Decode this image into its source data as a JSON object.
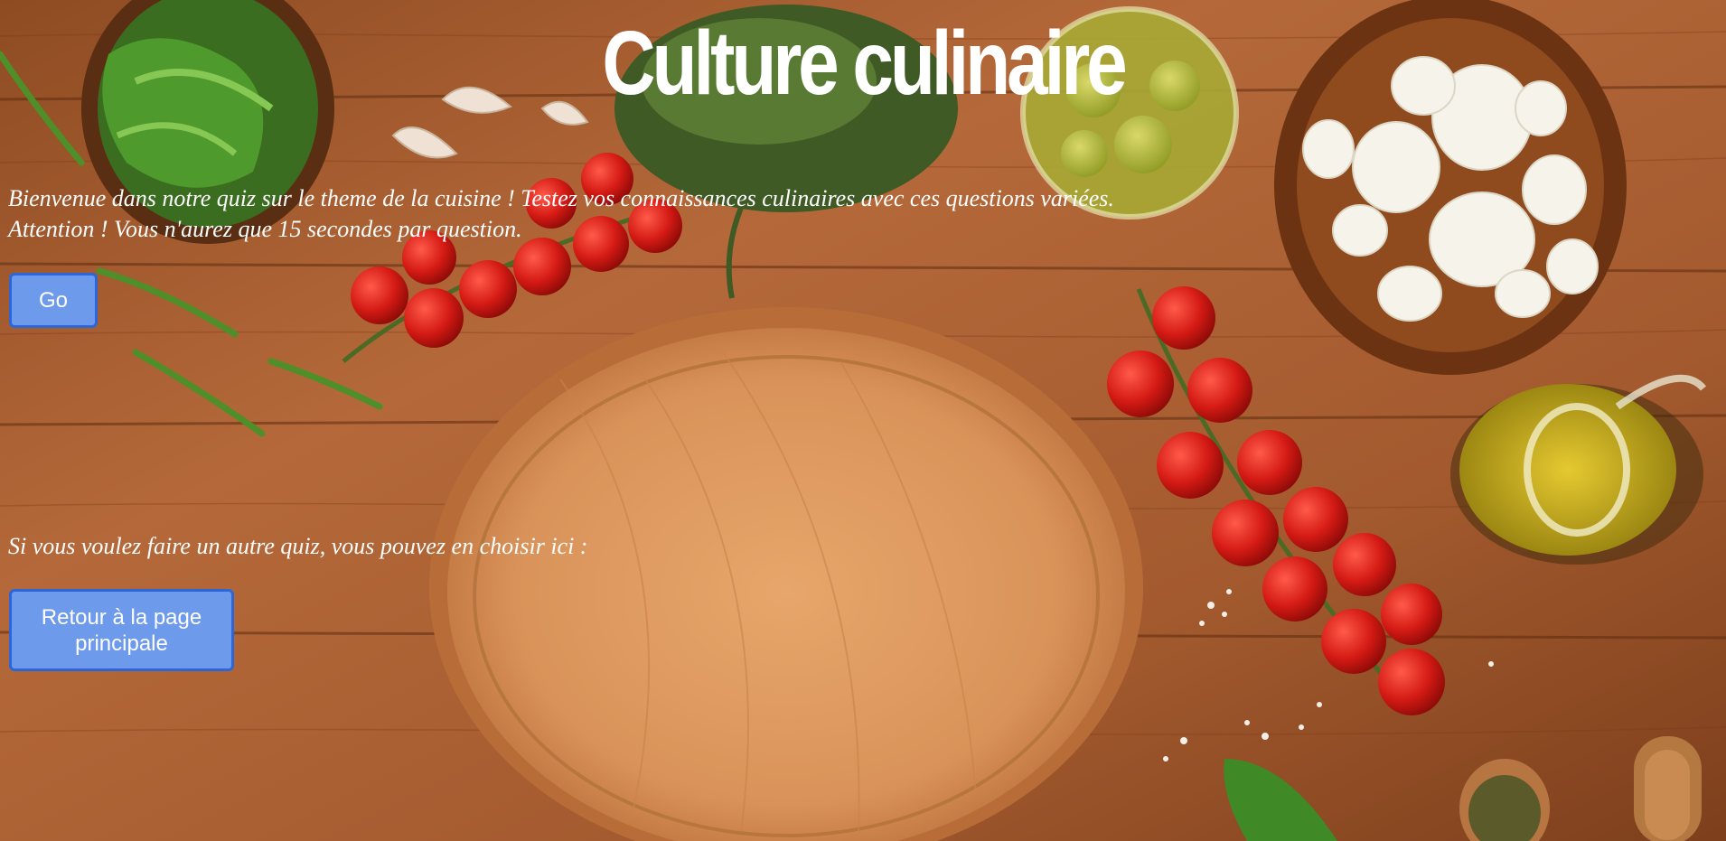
{
  "page": {
    "title": "Culture culinaire",
    "intro_line1": "Bienvenue dans notre quiz sur le theme de la cuisine ! Testez vos connaissances culinaires avec ces questions variées.",
    "intro_line2": "Attention ! Vous n'aurez que 15 secondes par question.",
    "go_label": "Go",
    "other_quiz_text": "Si vous voulez faire un autre quiz, vous pouvez en choisir ici :",
    "back_label": "Retour à la page principale"
  },
  "colors": {
    "button_fill": "#6e9aeb",
    "button_border": "#2b66db",
    "text": "#ffffff",
    "wood": "#b46a3a"
  },
  "background_items": [
    "arugula-bowl",
    "garlic-cloves",
    "herbs",
    "olive-jar",
    "mozzarella-bowl",
    "cherry-tomatoes",
    "wooden-pizza-board",
    "olive-oil-jug",
    "salt-crystals",
    "basil-leaf",
    "spice-spoon",
    "pepper-mill"
  ]
}
